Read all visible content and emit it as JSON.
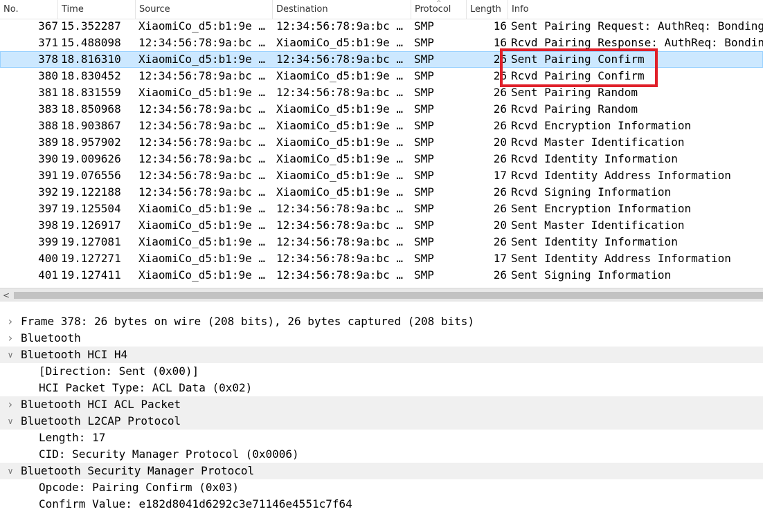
{
  "packet_list": {
    "columns": {
      "no": "No.",
      "time": "Time",
      "source": "Source",
      "destination": "Destination",
      "protocol": "Protocol",
      "length": "Length",
      "info": "Info"
    },
    "rows": [
      {
        "no": "367",
        "time": "15.352287",
        "source": "XiaomiCo_d5:b1:9e …",
        "destination": "12:34:56:78:9a:bc …",
        "protocol": "SMP",
        "length": "16",
        "info": "Sent Pairing Request: AuthReq: Bonding",
        "selected": false
      },
      {
        "no": "371",
        "time": "15.488098",
        "source": "12:34:56:78:9a:bc …",
        "destination": "XiaomiCo_d5:b1:9e …",
        "protocol": "SMP",
        "length": "16",
        "info": "Rcvd Pairing Response: AuthReq: Bonding",
        "selected": false
      },
      {
        "no": "378",
        "time": "18.816310",
        "source": "XiaomiCo_d5:b1:9e …",
        "destination": "12:34:56:78:9a:bc …",
        "protocol": "SMP",
        "length": "26",
        "info": "Sent Pairing Confirm",
        "selected": true
      },
      {
        "no": "380",
        "time": "18.830452",
        "source": "12:34:56:78:9a:bc …",
        "destination": "XiaomiCo_d5:b1:9e …",
        "protocol": "SMP",
        "length": "26",
        "info": "Rcvd Pairing Confirm",
        "selected": false
      },
      {
        "no": "381",
        "time": "18.831559",
        "source": "XiaomiCo_d5:b1:9e …",
        "destination": "12:34:56:78:9a:bc …",
        "protocol": "SMP",
        "length": "26",
        "info": "Sent Pairing Random",
        "selected": false
      },
      {
        "no": "383",
        "time": "18.850968",
        "source": "12:34:56:78:9a:bc …",
        "destination": "XiaomiCo_d5:b1:9e …",
        "protocol": "SMP",
        "length": "26",
        "info": "Rcvd Pairing Random",
        "selected": false
      },
      {
        "no": "388",
        "time": "18.903867",
        "source": "12:34:56:78:9a:bc …",
        "destination": "XiaomiCo_d5:b1:9e …",
        "protocol": "SMP",
        "length": "26",
        "info": "Rcvd Encryption Information",
        "selected": false
      },
      {
        "no": "389",
        "time": "18.957902",
        "source": "12:34:56:78:9a:bc …",
        "destination": "XiaomiCo_d5:b1:9e …",
        "protocol": "SMP",
        "length": "20",
        "info": "Rcvd Master Identification",
        "selected": false
      },
      {
        "no": "390",
        "time": "19.009626",
        "source": "12:34:56:78:9a:bc …",
        "destination": "XiaomiCo_d5:b1:9e …",
        "protocol": "SMP",
        "length": "26",
        "info": "Rcvd Identity Information",
        "selected": false
      },
      {
        "no": "391",
        "time": "19.076556",
        "source": "12:34:56:78:9a:bc …",
        "destination": "XiaomiCo_d5:b1:9e …",
        "protocol": "SMP",
        "length": "17",
        "info": "Rcvd Identity Address Information",
        "selected": false
      },
      {
        "no": "392",
        "time": "19.122188",
        "source": "12:34:56:78:9a:bc …",
        "destination": "XiaomiCo_d5:b1:9e …",
        "protocol": "SMP",
        "length": "26",
        "info": "Rcvd Signing Information",
        "selected": false
      },
      {
        "no": "397",
        "time": "19.125504",
        "source": "XiaomiCo_d5:b1:9e …",
        "destination": "12:34:56:78:9a:bc …",
        "protocol": "SMP",
        "length": "26",
        "info": "Sent Encryption Information",
        "selected": false
      },
      {
        "no": "398",
        "time": "19.126917",
        "source": "XiaomiCo_d5:b1:9e …",
        "destination": "12:34:56:78:9a:bc …",
        "protocol": "SMP",
        "length": "20",
        "info": "Sent Master Identification",
        "selected": false
      },
      {
        "no": "399",
        "time": "19.127081",
        "source": "XiaomiCo_d5:b1:9e …",
        "destination": "12:34:56:78:9a:bc …",
        "protocol": "SMP",
        "length": "26",
        "info": "Sent Identity Information",
        "selected": false
      },
      {
        "no": "400",
        "time": "19.127271",
        "source": "XiaomiCo_d5:b1:9e …",
        "destination": "12:34:56:78:9a:bc …",
        "protocol": "SMP",
        "length": "17",
        "info": "Sent Identity Address Information",
        "selected": false
      },
      {
        "no": "401",
        "time": "19.127411",
        "source": "XiaomiCo_d5:b1:9e …",
        "destination": "12:34:56:78:9a:bc …",
        "protocol": "SMP",
        "length": "26",
        "info": "Sent Signing Information",
        "selected": false
      }
    ],
    "selected_color": "#cce8ff",
    "highlight_color": "#e0202a"
  },
  "details": {
    "items": [
      {
        "label": "Frame 378: 26 bytes on wire (208 bits), 26 bytes captured (208 bits)",
        "level": 0,
        "state": "collapsed",
        "shaded": false
      },
      {
        "label": "Bluetooth",
        "level": 0,
        "state": "collapsed",
        "shaded": false
      },
      {
        "label": "Bluetooth HCI H4",
        "level": 0,
        "state": "expanded",
        "shaded": true
      },
      {
        "label": "[Direction: Sent (0x00)]",
        "level": 1,
        "state": "leaf",
        "shaded": false
      },
      {
        "label": "HCI Packet Type: ACL Data (0x02)",
        "level": 1,
        "state": "leaf",
        "shaded": false
      },
      {
        "label": "Bluetooth HCI ACL Packet",
        "level": 0,
        "state": "collapsed",
        "shaded": true
      },
      {
        "label": "Bluetooth L2CAP Protocol",
        "level": 0,
        "state": "expanded",
        "shaded": true
      },
      {
        "label": "Length: 17",
        "level": 1,
        "state": "leaf",
        "shaded": false
      },
      {
        "label": "CID: Security Manager Protocol (0x0006)",
        "level": 1,
        "state": "leaf",
        "shaded": false
      },
      {
        "label": "Bluetooth Security Manager Protocol",
        "level": 0,
        "state": "expanded",
        "shaded": true
      },
      {
        "label": "Opcode: Pairing Confirm (0x03)",
        "level": 1,
        "state": "leaf",
        "shaded": false
      },
      {
        "label": "Confirm Value: e182d8041d6292c3e71146e4551c7f64",
        "level": 1,
        "state": "leaf",
        "shaded": false
      }
    ]
  },
  "icons": {
    "collapsed": "chevron-right-icon",
    "expanded": "chevron-down-icon",
    "scroll_left": "chevron-left-icon"
  }
}
